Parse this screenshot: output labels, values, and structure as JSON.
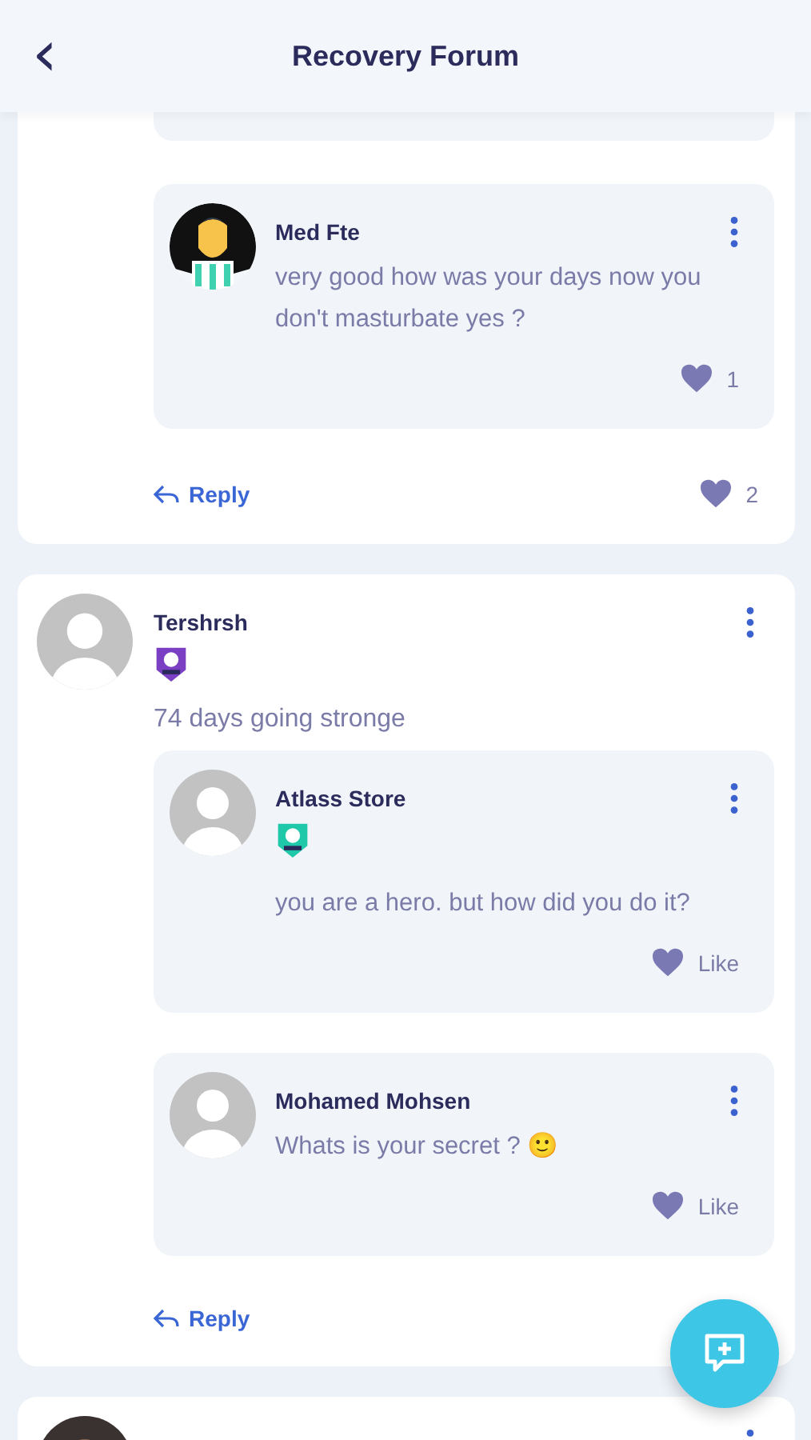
{
  "header": {
    "back_icon": "‹",
    "title": "Recovery Forum"
  },
  "threads": [
    {
      "kind": "partial",
      "replies": [
        {
          "kind": "partial"
        },
        {
          "kind": "comment",
          "author": "Med Fte",
          "avatar": {
            "kind": "figure"
          },
          "text": "very good how was your days now you don't masturbate yes ?",
          "like_label": "1"
        }
      ],
      "reply_label": "Reply",
      "like_label": "2"
    },
    {
      "kind": "post",
      "author": "Tershrsh",
      "avatar": {
        "kind": "default"
      },
      "badge": {
        "color": "#7b3fc4"
      },
      "text": "74 days going stronge",
      "replies": [
        {
          "kind": "comment",
          "author": "Atlass Store",
          "avatar": {
            "kind": "default"
          },
          "badge": {
            "color": "#1fc8a8"
          },
          "text": "you are a hero. but how did you do it?",
          "like_label": "Like"
        },
        {
          "kind": "comment",
          "author": "Mohamed Mohsen",
          "avatar": {
            "kind": "default"
          },
          "text": "Whats is your secret ? 🙂",
          "like_label": "Like"
        }
      ],
      "reply_label": "Reply"
    },
    {
      "kind": "cut"
    }
  ]
}
